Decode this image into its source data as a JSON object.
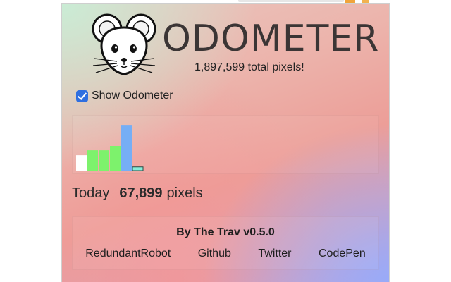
{
  "app": {
    "title": "ODOMETER",
    "total_line": "1,897,599 total pixels!"
  },
  "toggle": {
    "label": "Show Odometer",
    "checked": true
  },
  "chart_data": {
    "type": "bar",
    "values": [
      25,
      33,
      33,
      40,
      73,
      6
    ],
    "colors": [
      "#ffffff",
      "#7df26c",
      "#7df26c",
      "#7df26c",
      "#76aef5",
      "#87ecd9"
    ],
    "ylim": [
      0,
      80
    ]
  },
  "today": {
    "label": "Today",
    "value": "67,899",
    "unit": "pixels"
  },
  "footer": {
    "byline": "By The Trav v0.5.0",
    "links": [
      "RedundantRobot",
      "Github",
      "Twitter",
      "CodePen"
    ]
  },
  "icons": {
    "logo": "mouse-face-icon",
    "checkbox": "checkmark-icon"
  }
}
